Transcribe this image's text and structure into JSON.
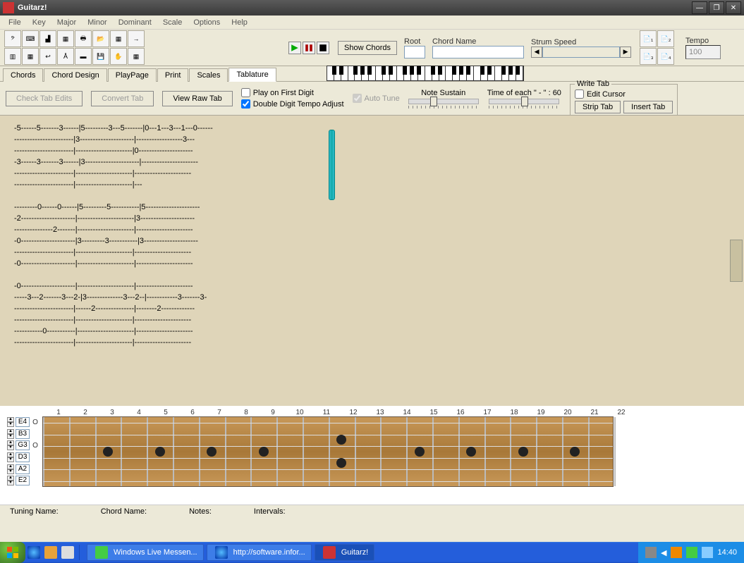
{
  "title": "Guitarz!",
  "menu": [
    "File",
    "Key",
    "Major",
    "Minor",
    "Dominant",
    "Scale",
    "Options",
    "Help"
  ],
  "toolbar": {
    "show_chords": "Show Chords"
  },
  "fields": {
    "root_label": "Root",
    "root_value": "",
    "chord_label": "Chord Name",
    "chord_value": "",
    "strum_label": "Strum Speed",
    "tempo_label": "Tempo",
    "tempo_value": "100"
  },
  "tabs": [
    "Chords",
    "Chord Design",
    "PlayPage",
    "Print",
    "Scales",
    "Tablature"
  ],
  "selected_tab": "Tablature",
  "control": {
    "check_tab": "Check Tab Edits",
    "convert_tab": "Convert Tab",
    "view_raw": "View Raw Tab",
    "play_first": "Play on First Digit",
    "auto_tune": "Auto Tune",
    "double_digit": "Double Digit Tempo Adjust",
    "note_sustain": "Note Sustain",
    "time_each": "Time of each \" - \" : 60",
    "write_tab": "Write Tab",
    "edit_cursor": "Edit Cursor",
    "strip_tab": "Strip Tab",
    "insert_tab": "Insert Tab"
  },
  "tablature_text": "-5------5-------3------|5---------3---5-------|0---1---3---1---0------\n-----------------------|3---------------------|------------------3---\n-----------------------|----------------------|0---------------------\n-3------3-------3------|3---------------------|----------------------\n-----------------------|----------------------|----------------------\n-----------------------|----------------------|---\n\n---------0------0------|5---------5-----------|5---------------------\n-2---------------------|----------------------|3---------------------\n---------------2-------|----------------------|----------------------\n-0---------------------|3---------3-----------|3---------------------\n-----------------------|----------------------|----------------------\n-0---------------------|----------------------|----------------------\n\n-0---------------------|----------------------|----------------------\n-----3---2-------3---2-|3--------------3---2--|------------3-------3-\n-----------------------|------2---------------|--------2-------------\n-----------------------|----------------------|----------------------\n-----------0-----------|----------------------|----------------------\n-----------------------|----------------------|----------------------",
  "fretboard": {
    "numbers": [
      "1",
      "2",
      "3",
      "4",
      "5",
      "6",
      "7",
      "8",
      "9",
      "10",
      "11",
      "12",
      "13",
      "14",
      "15",
      "16",
      "17",
      "18",
      "19",
      "20",
      "21",
      "22"
    ],
    "tunings": [
      "E4",
      "B3",
      "G3",
      "D3",
      "A2",
      "E2"
    ],
    "open_markers": [
      "O",
      "",
      "O",
      "",
      "",
      ""
    ],
    "dot_frets": [
      3,
      5,
      7,
      9,
      12,
      15,
      17,
      19,
      21
    ]
  },
  "bottom": {
    "tuning_name": "Tuning Name:",
    "chord_name": "Chord Name:",
    "notes": "Notes:",
    "intervals": "Intervals:"
  },
  "taskbar": {
    "items": [
      "Windows Live Messen...",
      "http://software.infor...",
      "Guitarz!"
    ],
    "time": "14:40"
  }
}
